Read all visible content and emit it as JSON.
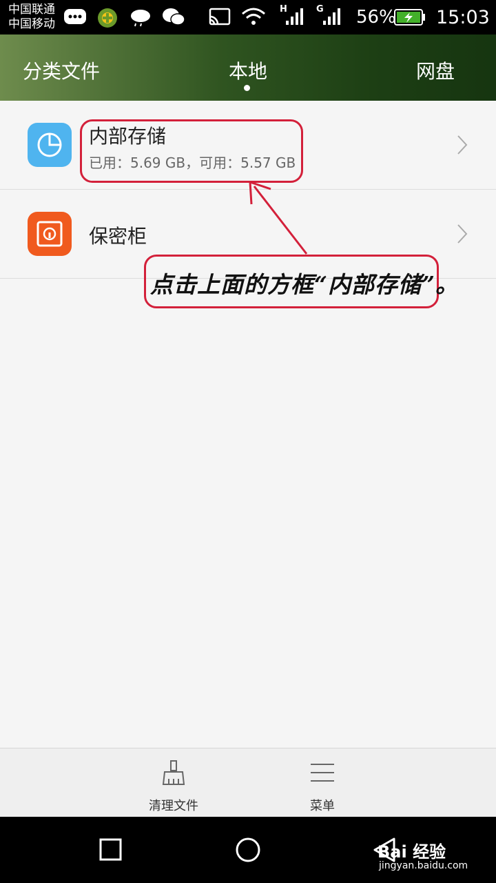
{
  "status_bar": {
    "carrier_1": "中国联通",
    "carrier_2": "中国移动",
    "network_1": "H",
    "network_2": "G",
    "battery": "56%",
    "time": "15:03"
  },
  "tabs": [
    {
      "label": "分类文件",
      "active": false
    },
    {
      "label": "本地",
      "active": true
    },
    {
      "label": "网盘",
      "active": false
    }
  ],
  "list": [
    {
      "title": "内部存储",
      "subtitle": "已用：5.69 GB，可用：5.57 GB",
      "icon": "pie-chart-icon",
      "icon_color": "#4fb4ef"
    },
    {
      "title": "保密柜",
      "subtitle": "",
      "icon": "safe-icon",
      "icon_color": "#f05a1e"
    }
  ],
  "annotation": {
    "text": "点击上面的方框“内部存储”。",
    "color": "#d3203a"
  },
  "toolbar": {
    "clean_label": "清理文件",
    "menu_label": "菜单"
  },
  "watermark": {
    "brand": "Bai 经验",
    "url": "jingyan.baidu.com"
  }
}
